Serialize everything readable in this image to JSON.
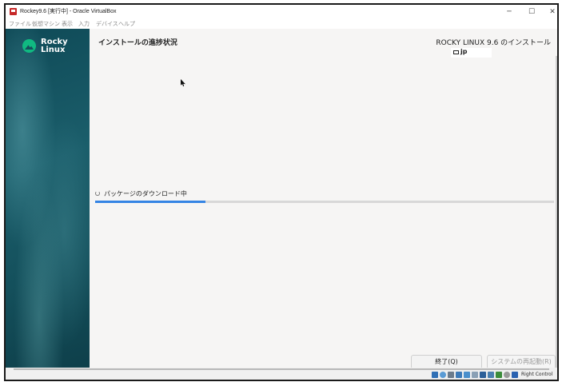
{
  "window": {
    "title": "Rockey9.6 [実行中] - Oracle VirtualBox",
    "controls": {
      "minimize": "─",
      "maximize": "☐",
      "close": "✕"
    }
  },
  "menubar": {
    "items": [
      "ファイル",
      "仮想マシン",
      "表示",
      "入力",
      "デバイス",
      "ヘルプ"
    ]
  },
  "sidebar": {
    "logo_line1": "Rocky",
    "logo_line2": "Linux",
    "logo_color": "#10b981"
  },
  "installer": {
    "page_title": "インストールの進捗状況",
    "product_title": "ROCKY LINUX 9.6 のインストール",
    "keyboard_layout": "jp",
    "progress": {
      "label": "パッケージのダウンロード中",
      "fraction": 0.24,
      "color": "#3584e4"
    },
    "buttons": {
      "quit": "終了(Q)",
      "reboot": "システムの再起動(R)"
    }
  },
  "statusbar": {
    "host_key": "Right Control",
    "tray_icons": [
      "hard-disk-icon",
      "optical-drive-icon",
      "audio-icon",
      "network-icon",
      "usb-icon",
      "shared-folders-icon",
      "display-icon",
      "recording-icon",
      "cpu-icon",
      "mouse-integration-icon",
      "keyboard-icon"
    ]
  }
}
